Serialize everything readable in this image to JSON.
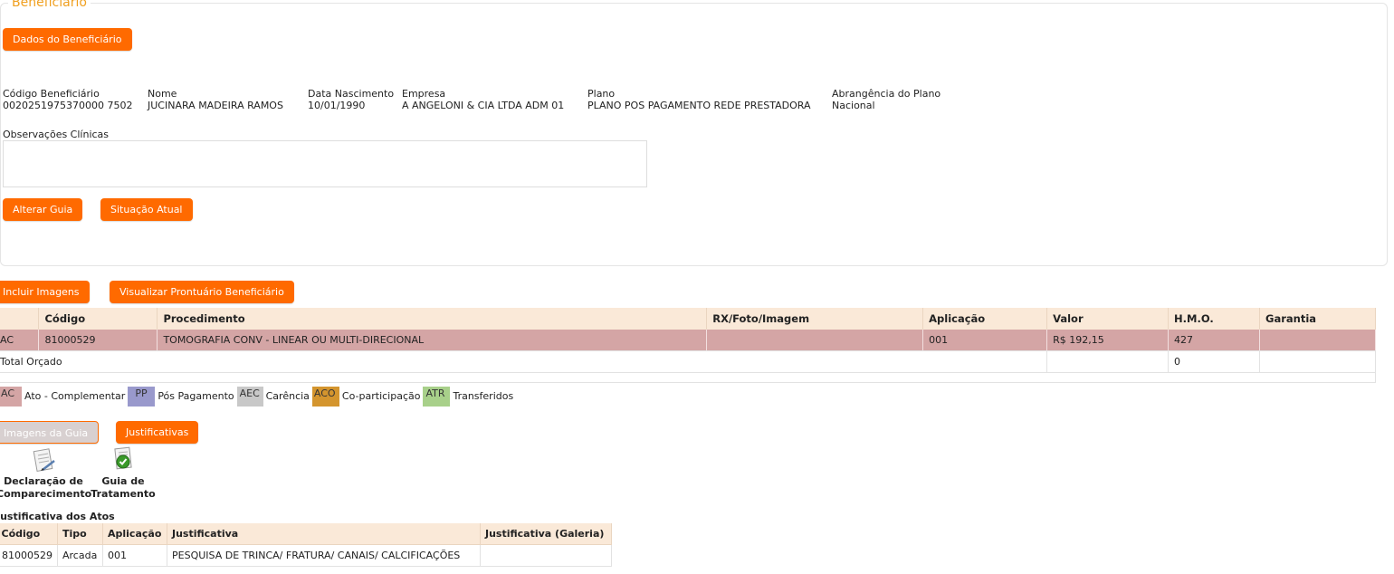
{
  "beneficiario": {
    "legend": "Beneficiário",
    "dados_button": "Dados do Beneficiário",
    "fields": [
      {
        "label": "Código Beneficiário",
        "value": "0020251975370000 7502"
      },
      {
        "label": "Nome",
        "value": "JUCINARA MADEIRA RAMOS"
      },
      {
        "label": "Data Nascimento",
        "value": "10/01/1990"
      },
      {
        "label": "Empresa",
        "value": "A ANGELONI & CIA LTDA ADM 01"
      },
      {
        "label": "Plano",
        "value": "PLANO POS PAGAMENTO REDE PRESTADORA"
      },
      {
        "label": "Abrangência do Plano",
        "value": "Nacional"
      }
    ],
    "observacoes_label": "Observações Clínicas",
    "observacoes_value": "",
    "alterar_guia_button": "Alterar Guia",
    "situacao_atual_button": "Situação Atual"
  },
  "actions": {
    "incluir_imagens_button": "Incluir Imagens",
    "visualizar_prontuario_button": "Visualizar Prontuário Beneficiário"
  },
  "procedures": {
    "headers": [
      "",
      "Código",
      "Procedimento",
      "RX/Foto/Imagem",
      "Aplicação",
      "Valor",
      "H.M.O.",
      "Garantia"
    ],
    "rows": [
      [
        "AC",
        "81000529",
        "TOMOGRAFIA CONV - LINEAR OU MULTI-DIRECIONAL",
        "",
        "001",
        "R$ 192,15",
        "427",
        ""
      ]
    ],
    "total_label": "Total Orçado",
    "total_hmo": "0"
  },
  "legend": [
    {
      "code": "AC",
      "label": "Ato - Complementar",
      "color": "#d4a5a5"
    },
    {
      "code": "PP",
      "label": "Pós Pagamento",
      "color": "#9999cc"
    },
    {
      "code": "AEC",
      "label": "Carência",
      "color": "#c8c8c8"
    },
    {
      "code": "ACO",
      "label": "Co-participação",
      "color": "#d4952e"
    },
    {
      "code": "ATR",
      "label": "Transferidos",
      "color": "#a8d08a"
    }
  ],
  "guide_buttons": {
    "imagens_da_guia": "Imagens da Guia",
    "justificativas": "Justificativas"
  },
  "documents": {
    "declaracao_line1": "Declaração de",
    "declaracao_line2": "Comparecimento",
    "guia_line1": "Guia de",
    "guia_line2": "Tratamento"
  },
  "justificativas": {
    "title": "Justificativa dos Atos",
    "headers": [
      "Código",
      "Tipo",
      "Aplicação",
      "Justificativa",
      "Justificativa (Galeria)"
    ],
    "rows": [
      [
        "81000529",
        "Arcada",
        "001",
        "PESQUISA DE TRINCA/ FRATURA/ CANAIS/ CALCIFICAÇÕES",
        ""
      ]
    ]
  }
}
